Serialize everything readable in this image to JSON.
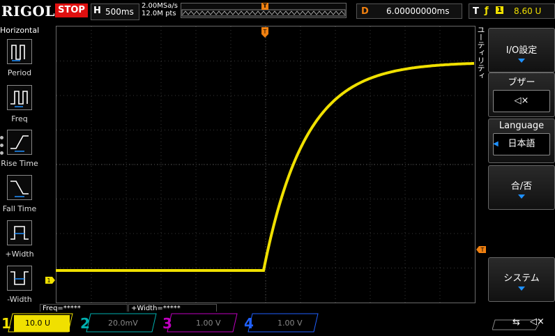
{
  "top": {
    "brand": "RIGOL",
    "run_state": "STOP",
    "horizontal_label": "H",
    "timebase": "500ms",
    "sample_rate": "2.00MSa/s",
    "memory_depth": "12.0M pts",
    "delay_label": "D",
    "delay_value": "6.00000000ms",
    "trigger_label": "T",
    "trigger_source": "1",
    "trigger_level": "8.60 U"
  },
  "left": {
    "section": "Horizontal",
    "items": [
      "Period",
      "Freq",
      "Rise Time",
      "Fall Time",
      "+Width",
      "-Width"
    ]
  },
  "right": {
    "utility": "ユーティリティ",
    "io": "I/O設定",
    "buzzer": "ブザー",
    "buzzer_icon": "◁×",
    "language_title": "Language",
    "language_value": "日本語",
    "pass_fail": "合/否",
    "system": "システム"
  },
  "measure": {
    "freq": "Freq=*****",
    "width": "+Width=*****"
  },
  "channels": [
    {
      "num": "1",
      "scale": "10.0 U",
      "color": "#f0e000"
    },
    {
      "num": "2",
      "scale": "20.0mV",
      "color": "#00b0b0"
    },
    {
      "num": "3",
      "scale": "1.00 V",
      "color": "#c000c0"
    },
    {
      "num": "4",
      "scale": "1.00 V",
      "color": "#2060ff"
    }
  ],
  "status_icons": [
    "usb-icon",
    "speaker-mute-icon"
  ],
  "colors": {
    "trace": "#f0e000",
    "trigger": "#f08010",
    "menu_arrow": "#1e90ff"
  }
}
